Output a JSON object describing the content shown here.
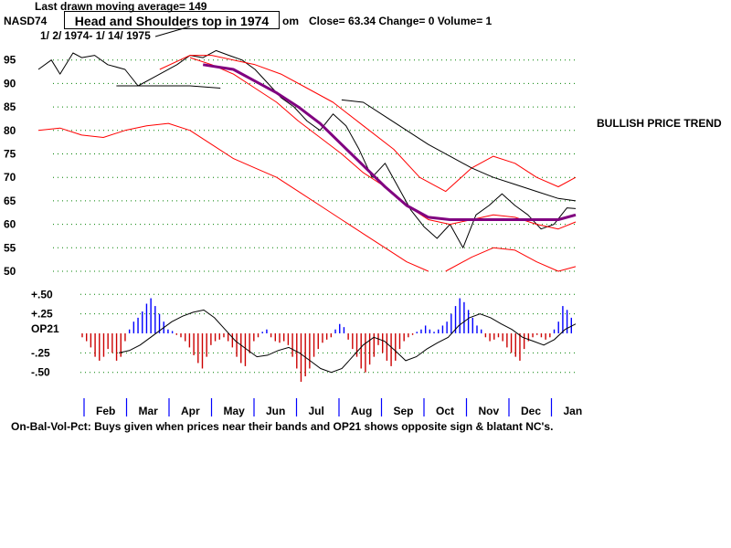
{
  "header": {
    "ticker": "NASD74",
    "moving_average_note": "Last drawn moving average= 149",
    "date_range": "1/ 2/ 1974- 1/ 14/ 1975",
    "stats_suffix": "om",
    "stats": "Close=  63.34  Change= 0 Volume= 1"
  },
  "callout": "Head and Shoulders top in 1974",
  "trend_label": "BULLISH PRICE TREND",
  "footer_note": "On-Bal-Vol-Pct: Buys given when prices near their bands and OP21 shows opposite sign & blatant NC's.",
  "colors": {
    "price": "#000000",
    "bands": "#ff0000",
    "moving_average": "#800080",
    "grid": "#008000",
    "positive_bars": "#0000ff",
    "negative_bars": "#cc0000",
    "month_ticks": "#0000ff"
  },
  "chart_data": [
    {
      "type": "line",
      "title": "",
      "ylim": [
        50,
        100
      ],
      "yticks": [
        95,
        90,
        85,
        80,
        75,
        70,
        65,
        60,
        55,
        50
      ],
      "grid": true,
      "months": [
        "Feb",
        "Mar",
        "Apr",
        "May",
        "Jun",
        "Jul",
        "Aug",
        "Sep",
        "Oct",
        "Nov",
        "Dec",
        "Jan"
      ],
      "series": [
        {
          "role": "price",
          "color": "#000000",
          "width": 1,
          "x": [
            0.0,
            0.3,
            0.5,
            0.8,
            1.0,
            1.3,
            1.6,
            2.0,
            2.3,
            2.6,
            2.9,
            3.2,
            3.5,
            3.8,
            4.1,
            4.4,
            4.7,
            5.0,
            5.3,
            5.6,
            5.9,
            6.2,
            6.5,
            6.8,
            7.1,
            7.4,
            7.7,
            8.0,
            8.3,
            8.6,
            8.9,
            9.2,
            9.5,
            9.8,
            10.1,
            10.4,
            10.7,
            11.0,
            11.3,
            11.6,
            11.9,
            12.2,
            12.4
          ],
          "y": [
            93,
            95,
            92,
            96.5,
            95.5,
            96,
            94,
            93,
            89.5,
            91,
            92.5,
            94,
            96,
            95.5,
            97,
            96,
            95,
            93,
            90,
            87,
            85,
            82,
            80,
            83.5,
            81,
            76,
            70,
            73,
            68,
            63,
            59.5,
            57,
            60,
            55,
            62,
            64,
            66.5,
            64,
            62,
            59,
            60,
            63.5,
            63.34
          ]
        },
        {
          "role": "upper-band",
          "color": "#ff0000",
          "width": 1,
          "x": [
            2.8,
            3.5,
            4.0,
            4.5,
            5.0,
            5.6,
            6.2,
            6.8,
            7.5,
            8.2,
            8.8,
            9.4,
            10.0,
            10.5,
            11.0,
            11.5,
            12.0,
            12.4
          ],
          "y": [
            93,
            96,
            96,
            95,
            94,
            92,
            89,
            86,
            81,
            76,
            70,
            67,
            72,
            74.5,
            73,
            70,
            68,
            70
          ]
        },
        {
          "role": "lower-band",
          "color": "#ff0000",
          "width": 1,
          "x": [
            0.0,
            0.5,
            1.0,
            1.5,
            2.0,
            2.5,
            3.0,
            3.5,
            4.0,
            4.5,
            5.0,
            5.5,
            6.0,
            6.5,
            7.0,
            7.5,
            8.0,
            8.5,
            9.0
          ],
          "y": [
            80,
            80.5,
            79,
            78.5,
            80,
            81,
            81.5,
            80,
            77,
            74,
            72,
            70,
            67,
            64,
            61,
            58,
            55,
            52,
            50
          ]
        },
        {
          "role": "lower-band-2",
          "color": "#ff0000",
          "width": 1,
          "x": [
            9.4,
            10.0,
            10.5,
            11.0,
            11.5,
            12.0,
            12.4
          ],
          "y": [
            50,
            53,
            55,
            54.5,
            52,
            50,
            51
          ]
        },
        {
          "role": "price-band-mid",
          "color": "#ff0000",
          "width": 1,
          "x": [
            3.5,
            4.0,
            4.5,
            5.0,
            5.5,
            6.0,
            6.5,
            7.0,
            7.5,
            8.0,
            8.5,
            9.0,
            9.5,
            10.0,
            10.5,
            11.0,
            11.5,
            12.0,
            12.4
          ],
          "y": [
            95.5,
            94,
            92,
            89,
            86,
            82,
            78.5,
            75,
            71,
            68,
            64,
            61,
            60,
            61,
            62,
            61.5,
            60,
            59,
            60.5
          ]
        },
        {
          "role": "moving-average",
          "color": "#800080",
          "width": 3,
          "x": [
            3.8,
            4.5,
            5.0,
            5.5,
            6.0,
            6.5,
            7.0,
            7.5,
            8.0,
            8.5,
            9.0,
            9.5,
            10.0,
            10.5,
            11.0,
            11.5,
            12.0,
            12.4
          ],
          "y": [
            94,
            93,
            90.5,
            88,
            85,
            81.5,
            77,
            72.5,
            68,
            64,
            61.5,
            61,
            61,
            61,
            61,
            61,
            61,
            62
          ]
        },
        {
          "role": "long-moving-average",
          "color": "#000000",
          "width": 1,
          "x": [
            7.0,
            7.5,
            8.0,
            8.5,
            9.0,
            9.5,
            10.0,
            10.5,
            11.0,
            11.5,
            12.0,
            12.4
          ],
          "y": [
            86.5,
            86,
            83,
            80,
            77,
            74.5,
            72,
            70,
            68.5,
            67,
            65.5,
            65
          ]
        },
        {
          "role": "neckline",
          "color": "#000000",
          "width": 1,
          "x": [
            1.8,
            3.5,
            4.2
          ],
          "y": [
            89.5,
            89.5,
            89
          ]
        }
      ]
    },
    {
      "type": "bar",
      "title": "",
      "ylabel": "OP21",
      "ylim": [
        -0.62,
        0.62
      ],
      "yticks": [
        0.5,
        0.25,
        -0.25,
        -0.5
      ],
      "ytick_labels": [
        "+.50",
        "+.25",
        "-.25",
        "-.50"
      ],
      "grid": true,
      "values": [
        -0.05,
        -0.1,
        -0.18,
        -0.3,
        -0.35,
        -0.3,
        -0.2,
        -0.25,
        -0.35,
        -0.3,
        -0.1,
        0.05,
        0.15,
        0.2,
        0.28,
        0.38,
        0.45,
        0.35,
        0.25,
        0.15,
        0.05,
        0.03,
        -0.02,
        -0.05,
        -0.1,
        -0.18,
        -0.28,
        -0.38,
        -0.45,
        -0.3,
        -0.15,
        -0.1,
        -0.08,
        -0.05,
        -0.1,
        -0.18,
        -0.3,
        -0.38,
        -0.42,
        -0.25,
        -0.1,
        -0.05,
        0.02,
        0.05,
        -0.05,
        -0.1,
        -0.12,
        -0.1,
        -0.15,
        -0.3,
        -0.45,
        -0.62,
        -0.55,
        -0.45,
        -0.3,
        -0.2,
        -0.12,
        -0.08,
        -0.05,
        0.05,
        0.12,
        0.08,
        -0.08,
        -0.2,
        -0.3,
        -0.45,
        -0.5,
        -0.4,
        -0.3,
        -0.15,
        -0.25,
        -0.35,
        -0.42,
        -0.35,
        -0.2,
        -0.1,
        -0.05,
        -0.02,
        0.02,
        0.05,
        0.1,
        0.05,
        0.02,
        0.05,
        0.1,
        0.15,
        0.25,
        0.35,
        0.45,
        0.4,
        0.3,
        0.2,
        0.1,
        0.05,
        -0.05,
        -0.1,
        -0.08,
        -0.05,
        -0.1,
        -0.18,
        -0.25,
        -0.3,
        -0.35,
        -0.2,
        -0.1,
        -0.05,
        -0.02,
        -0.05,
        -0.08,
        -0.05,
        0.05,
        0.15,
        0.35,
        0.3,
        0.2
      ],
      "line": [
        -0.25,
        -0.22,
        -0.15,
        -0.05,
        0.05,
        0.15,
        0.22,
        0.27,
        0.3,
        0.2,
        0.05,
        -0.1,
        -0.2,
        -0.3,
        -0.28,
        -0.22,
        -0.18,
        -0.25,
        -0.35,
        -0.45,
        -0.5,
        -0.45,
        -0.3,
        -0.15,
        -0.05,
        -0.1,
        -0.22,
        -0.35,
        -0.3,
        -0.2,
        -0.12,
        -0.05,
        0.1,
        0.2,
        0.25,
        0.2,
        0.12,
        0.05,
        -0.05,
        -0.1,
        -0.15,
        -0.08,
        0.05,
        0.12
      ]
    }
  ]
}
